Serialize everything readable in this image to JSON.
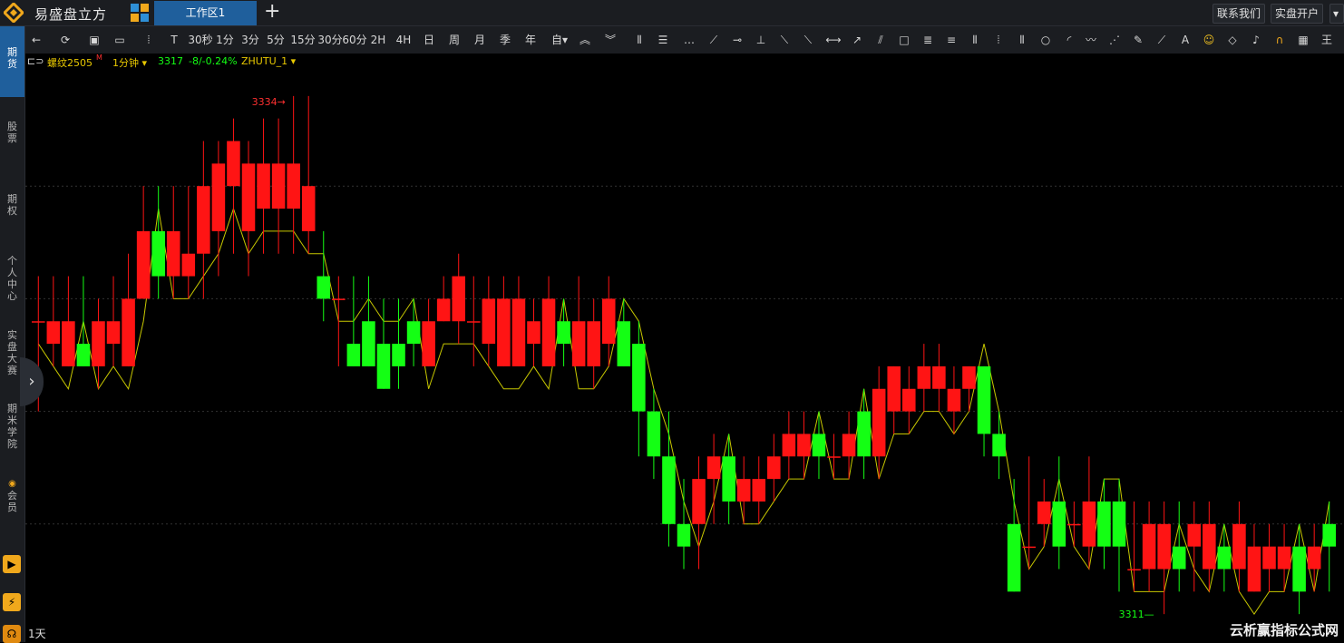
{
  "app": {
    "name": "易盛盘立方",
    "tab": "工作区1"
  },
  "topright": {
    "contact": "联系我们",
    "open_account": "实盘开户"
  },
  "toolbar": {
    "periods": [
      "30秒",
      "1分",
      "3分",
      "5分",
      "15分",
      "30分",
      "60分",
      "2H",
      "4H",
      "日",
      "周",
      "月",
      "季",
      "年",
      "自▾"
    ]
  },
  "sidebar": {
    "items": [
      {
        "label": "期货",
        "active": true
      },
      {
        "label": "股票"
      },
      {
        "label": "期权"
      },
      {
        "label": "个人中心"
      },
      {
        "label": "实盘大赛"
      },
      {
        "label": "期米学院"
      },
      {
        "label": "会员"
      }
    ]
  },
  "infobar": {
    "symbol": "螺纹2505",
    "symbol_flag": "M",
    "period": "1分钟 ▾",
    "last": "3317",
    "change": "-8/-0.24%",
    "indicator": "ZHUTU_1 ▾"
  },
  "chart_data": {
    "type": "candlestick",
    "symbol": "螺纹2505",
    "period": "1分钟",
    "ylim": [
      3310,
      3335
    ],
    "high_label": "3334",
    "low_label": "3311",
    "up_color": "#ff1414",
    "down_color": "#14ff14",
    "line_color": "#c8c800",
    "candles": [
      [
        3324,
        3324,
        3326,
        3320
      ],
      [
        3323,
        3324,
        3326,
        3322
      ],
      [
        3322,
        3324,
        3326,
        3322
      ],
      [
        3323,
        3322,
        3326,
        3322
      ],
      [
        3322,
        3324,
        3325,
        3321
      ],
      [
        3323,
        3324,
        3326,
        3322
      ],
      [
        3322,
        3325,
        3327,
        3322
      ],
      [
        3325,
        3328,
        3330,
        3325
      ],
      [
        3328,
        3326,
        3330,
        3325
      ],
      [
        3326,
        3328,
        3330,
        3325
      ],
      [
        3326,
        3327,
        3330,
        3325
      ],
      [
        3327,
        3330,
        3332,
        3325
      ],
      [
        3328,
        3331,
        3332,
        3326
      ],
      [
        3330,
        3332,
        3333,
        3327
      ],
      [
        3328,
        3331,
        3332,
        3326
      ],
      [
        3329,
        3331,
        3333,
        3327
      ],
      [
        3329,
        3331,
        3333,
        3327
      ],
      [
        3329,
        3331,
        3334,
        3327
      ],
      [
        3328,
        3330,
        3334,
        3327
      ],
      [
        3326,
        3325,
        3328,
        3324
      ],
      [
        3325,
        3325,
        3326,
        3322
      ],
      [
        3323,
        3322,
        3326,
        3322
      ],
      [
        3324,
        3322,
        3326,
        3322
      ],
      [
        3323,
        3321,
        3325,
        3321
      ],
      [
        3323,
        3322,
        3325,
        3321
      ],
      [
        3324,
        3323,
        3325,
        3322
      ],
      [
        3322,
        3324,
        3325,
        3322
      ],
      [
        3324,
        3325,
        3326,
        3324
      ],
      [
        3324,
        3326,
        3327,
        3323
      ],
      [
        3324,
        3324,
        3326,
        3322
      ],
      [
        3323,
        3325,
        3326,
        3322
      ],
      [
        3322,
        3325,
        3326,
        3322
      ],
      [
        3322,
        3325,
        3326,
        3322
      ],
      [
        3323,
        3324,
        3325,
        3322
      ],
      [
        3322,
        3325,
        3326,
        3322
      ],
      [
        3324,
        3323,
        3325,
        3322
      ],
      [
        3322,
        3324,
        3326,
        3322
      ],
      [
        3322,
        3324,
        3325,
        3321
      ],
      [
        3323,
        3325,
        3326,
        3322
      ],
      [
        3324,
        3322,
        3325,
        3322
      ],
      [
        3323,
        3320,
        3324,
        3318
      ],
      [
        3320,
        3318,
        3321,
        3317
      ],
      [
        3318,
        3315,
        3320,
        3314
      ],
      [
        3315,
        3314,
        3317,
        3313
      ],
      [
        3315,
        3317,
        3318,
        3313
      ],
      [
        3317,
        3318,
        3319,
        3315
      ],
      [
        3318,
        3316,
        3319,
        3315
      ],
      [
        3316,
        3317,
        3318,
        3315
      ],
      [
        3316,
        3317,
        3318,
        3315
      ],
      [
        3317,
        3318,
        3319,
        3316
      ],
      [
        3318,
        3319,
        3320,
        3317
      ],
      [
        3318,
        3319,
        3320,
        3317
      ],
      [
        3319,
        3318,
        3320,
        3317
      ],
      [
        3318,
        3318,
        3319,
        3317
      ],
      [
        3318,
        3319,
        3320,
        3317
      ],
      [
        3320,
        3318,
        3321,
        3317
      ],
      [
        3318,
        3321,
        3322,
        3317
      ],
      [
        3320,
        3322,
        3322,
        3319
      ],
      [
        3320,
        3321,
        3322,
        3319
      ],
      [
        3321,
        3322,
        3323,
        3320
      ],
      [
        3321,
        3322,
        3323,
        3320
      ],
      [
        3320,
        3321,
        3322,
        3319
      ],
      [
        3321,
        3322,
        3322,
        3320
      ],
      [
        3322,
        3319,
        3322,
        3318
      ],
      [
        3319,
        3318,
        3320,
        3317
      ],
      [
        3315,
        3312,
        3317,
        3312
      ],
      [
        3314,
        3314,
        3318,
        3313
      ],
      [
        3315,
        3316,
        3317,
        3314
      ],
      [
        3316,
        3314,
        3318,
        3313
      ],
      [
        3315,
        3315,
        3316,
        3314
      ],
      [
        3314,
        3316,
        3318,
        3313
      ],
      [
        3316,
        3314,
        3317,
        3313
      ],
      [
        3316,
        3314,
        3317,
        3312
      ],
      [
        3313,
        3313,
        3316,
        3312
      ],
      [
        3313,
        3315,
        3316,
        3312
      ],
      [
        3313,
        3315,
        3316,
        3311
      ],
      [
        3314,
        3313,
        3316,
        3312
      ],
      [
        3314,
        3315,
        3316,
        3312
      ],
      [
        3313,
        3315,
        3316,
        3312
      ],
      [
        3314,
        3313,
        3315,
        3312
      ],
      [
        3313,
        3315,
        3316,
        3312
      ],
      [
        3312,
        3314,
        3315,
        3312
      ],
      [
        3313,
        3314,
        3315,
        3312
      ],
      [
        3313,
        3314,
        3315,
        3312
      ],
      [
        3314,
        3312,
        3315,
        3311
      ],
      [
        3313,
        3314,
        3315,
        3312
      ],
      [
        3315,
        3314,
        3316,
        3312
      ]
    ]
  },
  "footer": {
    "period_label": "1天",
    "watermark": "云析赢指标公式网"
  }
}
